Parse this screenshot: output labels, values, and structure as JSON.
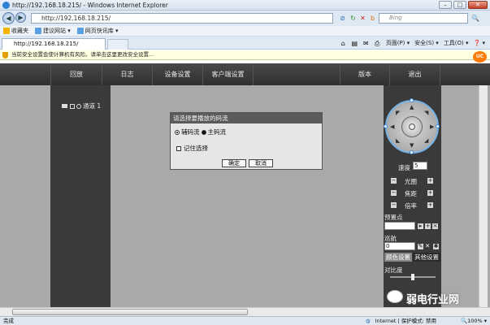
{
  "window": {
    "title": "http://192.168.18.215/ - Windows Internet Explorer",
    "minimize": "–",
    "maximize": "□",
    "close": "✕"
  },
  "browser": {
    "address": "http://192.168.18.215/",
    "search_placeholder": "Bing",
    "favorites_label": "收藏夹",
    "favorites_items": [
      "建议网站 ▾",
      "网页快讯库 ▾"
    ],
    "tab_title": "http://192.168.18.215/",
    "commands": [
      "页面(P) ▾",
      "安全(S) ▾",
      "工具(O) ▾",
      "❓ ▾"
    ],
    "info_text": "当前安全设置会使计算机有风险。请单击这里更改安全设置...",
    "status_left": "完成",
    "status_zone": "Internet | 保护模式: 禁用",
    "zoom": "🔍100% ▾"
  },
  "app": {
    "menu": [
      "回放",
      "日志",
      "设备设置",
      "客户端设置",
      "版本",
      "退出"
    ],
    "channel_label": "通道 1",
    "dialog": {
      "title": "请选择要播放的码流",
      "option1": "辅码流",
      "option2": "主码流",
      "remember": "记住选择",
      "ok": "确定",
      "cancel": "取消"
    },
    "ptz": {
      "speed_label": "速度",
      "speed_value": "5",
      "rows": [
        {
          "minus": "−",
          "label": "光圈",
          "plus": "+"
        },
        {
          "minus": "−",
          "label": "焦距",
          "plus": "+"
        },
        {
          "minus": "−",
          "label": "倍率",
          "plus": "+"
        }
      ],
      "preset_label": "预置点",
      "cruise_label": "巡航",
      "cruise_value": "0",
      "tab_color": "颜色设置",
      "tab_other": "其他设置",
      "contrast_label": "对比度"
    }
  },
  "watermark": {
    "text": "弱电行业网"
  }
}
